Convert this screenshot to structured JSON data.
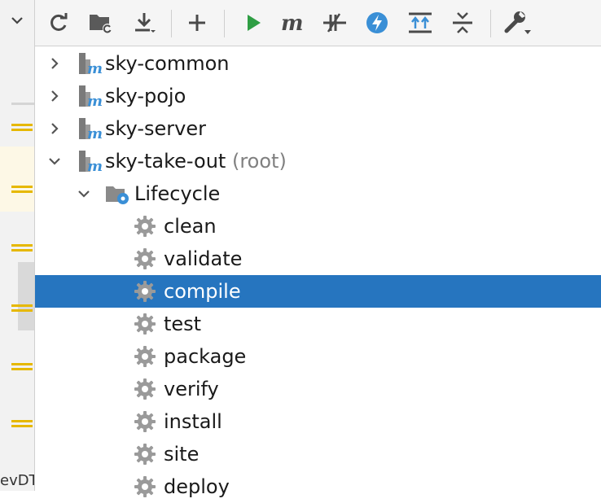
{
  "toolbar": {
    "buttons": [
      {
        "name": "reload-icon"
      },
      {
        "name": "folder-reload-icon"
      },
      {
        "name": "download-icon"
      },
      {
        "name": "add-icon"
      },
      {
        "name": "run-icon"
      },
      {
        "name": "maven-goal-icon"
      },
      {
        "name": "skip-tests-icon"
      },
      {
        "name": "offline-mode-icon"
      },
      {
        "name": "show-dependencies-icon"
      },
      {
        "name": "collapse-all-icon"
      },
      {
        "name": "settings-wrench-icon"
      }
    ]
  },
  "left_panel": {
    "edge_text": "evDT"
  },
  "tree": {
    "projects": [
      {
        "label": "sky-common",
        "suffix": ""
      },
      {
        "label": "sky-pojo",
        "suffix": ""
      },
      {
        "label": "sky-server",
        "suffix": ""
      },
      {
        "label": "sky-take-out",
        "suffix": "(root)"
      }
    ],
    "lifecycle_label": "Lifecycle",
    "phases": [
      "clean",
      "validate",
      "compile",
      "test",
      "package",
      "verify",
      "install",
      "site",
      "deploy"
    ],
    "selected_phase": "compile"
  },
  "colors": {
    "selection": "#2675bf",
    "run_green": "#2f9e44",
    "maven_blue": "#3a8fd6",
    "gear_gray": "#9a9a9a",
    "marker_yellow": "#e6b800"
  }
}
